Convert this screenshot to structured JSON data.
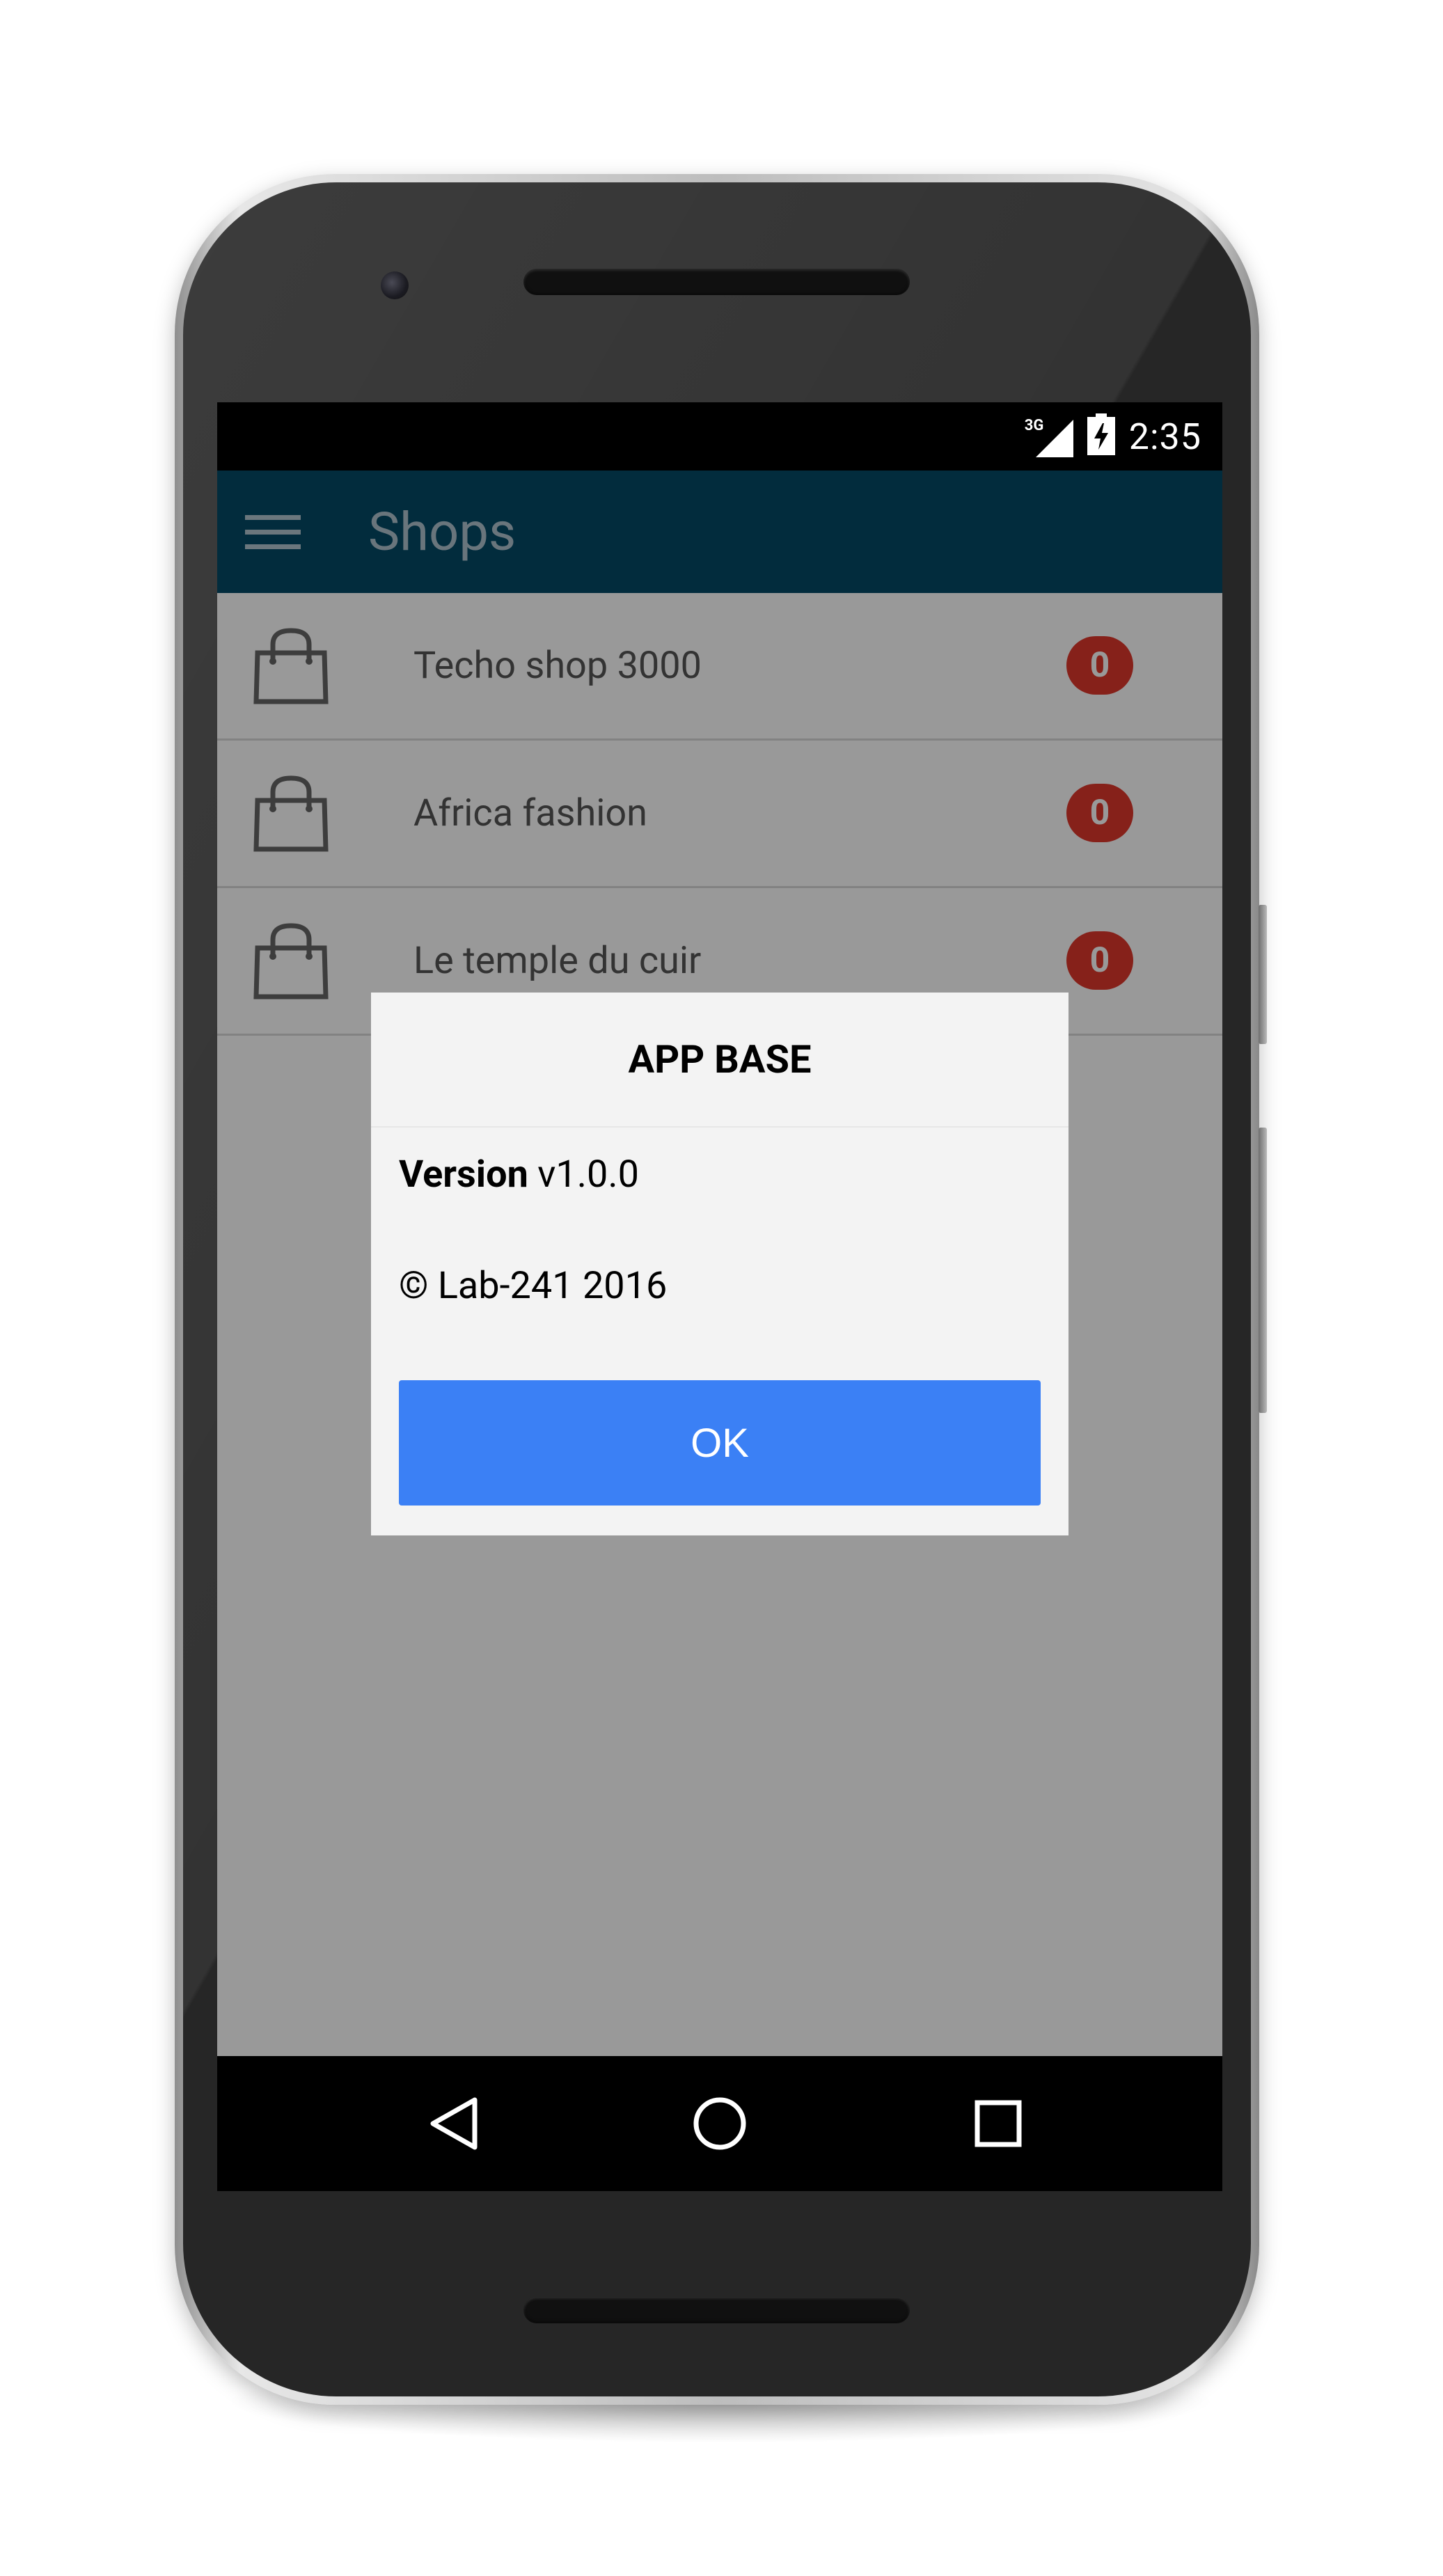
{
  "status_bar": {
    "network_type": "3G",
    "time": "2:35"
  },
  "app_bar": {
    "menu_icon": "hamburger-menu-icon",
    "title": "Shops"
  },
  "shops": [
    {
      "name": "Techo shop 3000",
      "count": "0",
      "icon": "shopping-bag-icon"
    },
    {
      "name": "Africa fashion",
      "count": "0",
      "icon": "shopping-bag-icon"
    },
    {
      "name": "Le temple du cuir",
      "count": "0",
      "icon": "shopping-bag-icon"
    }
  ],
  "dialog": {
    "title": "APP BASE",
    "version_label": "Version",
    "version_value": "v1.0.0",
    "copyright": "© Lab-241 2016",
    "ok_label": "OK"
  },
  "nav_bar": {
    "back_icon": "back-triangle-icon",
    "home_icon": "home-circle-icon",
    "recents_icon": "recents-square-icon"
  },
  "colors": {
    "app_bar": "#044a66",
    "badge": "#e0382c",
    "ok_button": "#3b80f5",
    "dialog_bg": "#f3f3f3"
  }
}
